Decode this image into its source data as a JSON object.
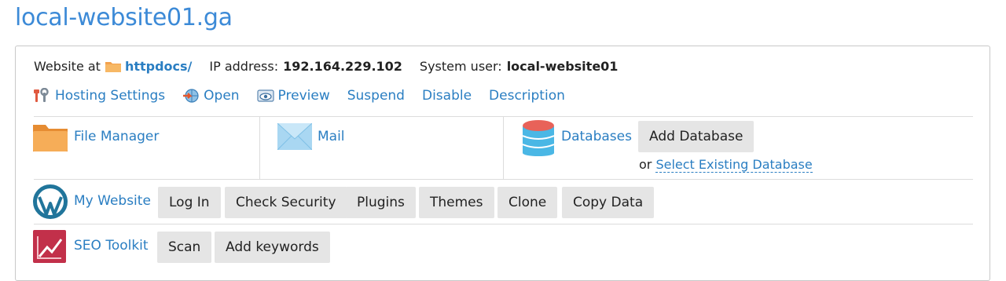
{
  "domain": {
    "name": "local-website01.ga"
  },
  "info": {
    "website_at_label": "Website at",
    "docroot_link": "httpdocs/",
    "ip_label": "IP address:",
    "ip_value": "192.164.229.102",
    "user_label": "System user:",
    "user_value": "local-website01"
  },
  "actions": {
    "hosting_settings": "Hosting Settings",
    "open": "Open",
    "preview": "Preview",
    "suspend": "Suspend",
    "disable": "Disable",
    "description": "Description"
  },
  "tiles": {
    "file_manager": "File Manager",
    "mail": "Mail",
    "databases": "Databases",
    "add_database": "Add Database",
    "or_text": "or",
    "select_existing_database": "Select Existing Database"
  },
  "wordpress": {
    "label": "My Website",
    "buttons": [
      "Log In",
      "Check Security",
      "Plugins",
      "Themes",
      "Clone",
      "Copy Data"
    ]
  },
  "seo": {
    "label": "SEO Toolkit",
    "buttons": [
      "Scan",
      "Add keywords"
    ]
  },
  "icons": {
    "folder": "folder-icon",
    "hosting": "tools-icon",
    "open": "globe-arrow-icon",
    "preview": "eye-icon",
    "mail": "envelope-icon",
    "databases": "database-icon",
    "wordpress": "wordpress-icon",
    "seo": "seo-chart-icon"
  },
  "colors": {
    "link": "#2a7ec2",
    "title": "#3c8ad7",
    "button_bg": "#e5e5e5",
    "folder": "#f3a24d",
    "database": "#4ab7e5",
    "database_top": "#e86259",
    "seo": "#c2304a"
  }
}
